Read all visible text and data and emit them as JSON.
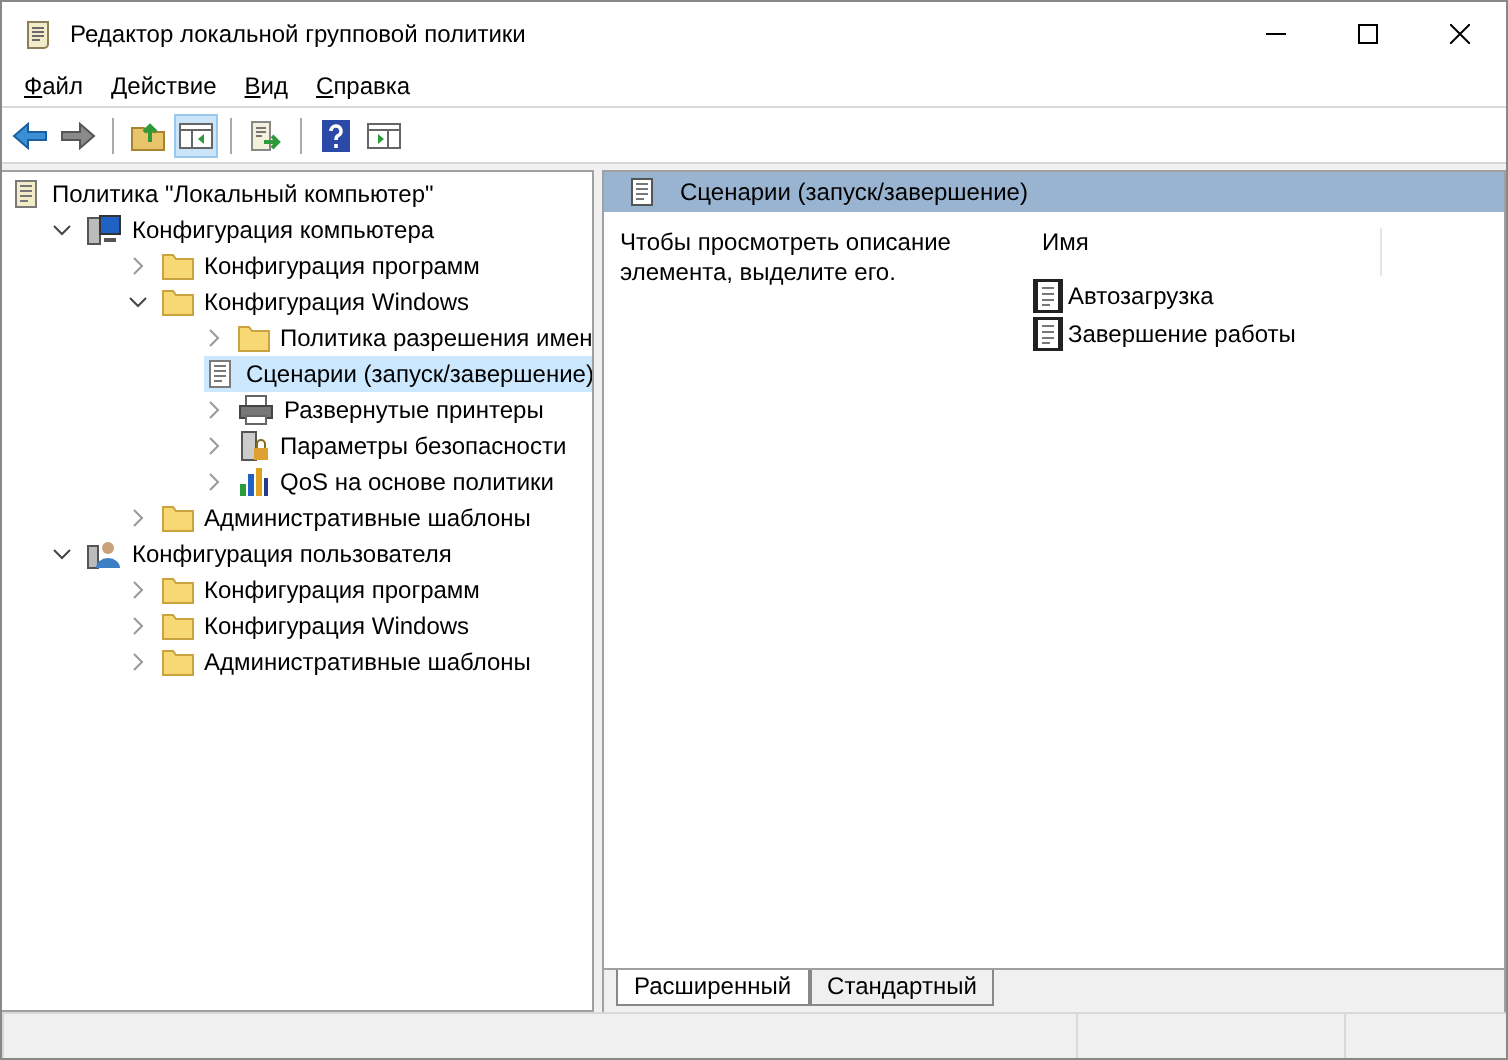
{
  "window": {
    "title": "Редактор локальной групповой политики"
  },
  "menu": [
    {
      "label": "Файл"
    },
    {
      "label": "Действие"
    },
    {
      "label": "Вид"
    },
    {
      "label": "Справка"
    }
  ],
  "toolbar": [
    {
      "kind": "back",
      "pressed": false
    },
    {
      "kind": "forward",
      "pressed": false
    },
    {
      "kind": "sep"
    },
    {
      "kind": "up",
      "pressed": false
    },
    {
      "kind": "tree",
      "pressed": true
    },
    {
      "kind": "sep"
    },
    {
      "kind": "export",
      "pressed": false
    },
    {
      "kind": "sep"
    },
    {
      "kind": "help",
      "pressed": false
    },
    {
      "kind": "pane",
      "pressed": false
    }
  ],
  "tree": [
    {
      "label": "Политика \"Локальный компьютер\"",
      "kind": "document",
      "selected": false,
      "children": [
        {
          "label": "Конфигурация компьютера",
          "kind": "computer",
          "expanded": true,
          "selected": false,
          "children": [
            {
              "label": "Конфигурация программ",
              "kind": "folder",
              "expanded": false,
              "selected": false
            },
            {
              "label": "Конфигурация Windows",
              "kind": "folder",
              "expanded": true,
              "selected": false,
              "children": [
                {
                  "label": "Политика разрешения имен",
                  "kind": "folder",
                  "expanded": false,
                  "selected": false
                },
                {
                  "label": "Сценарии (запуск/завершение)",
                  "kind": "script",
                  "selected": true
                },
                {
                  "label": "Развернутые принтеры",
                  "kind": "printer",
                  "expanded": false,
                  "selected": false
                },
                {
                  "label": "Параметры безопасности",
                  "kind": "security",
                  "expanded": false,
                  "selected": false
                },
                {
                  "label": "QoS на основе политики",
                  "kind": "chart",
                  "expanded": false,
                  "selected": false
                }
              ]
            },
            {
              "label": "Административные шаблоны",
              "kind": "folder",
              "expanded": false,
              "selected": false
            }
          ]
        },
        {
          "label": "Конфигурация пользователя",
          "kind": "user",
          "expanded": true,
          "selected": false,
          "children": [
            {
              "label": "Конфигурация программ",
              "kind": "folder",
              "expanded": false,
              "selected": false
            },
            {
              "label": "Конфигурация Windows",
              "kind": "folder",
              "expanded": false,
              "selected": false
            },
            {
              "label": "Административные шаблоны",
              "kind": "folder",
              "expanded": false,
              "selected": false
            }
          ]
        }
      ]
    }
  ],
  "details": {
    "header": "Сценарии (запуск/завершение)",
    "description": "Чтобы просмотреть описание элемента, выделите его.",
    "column": "Имя",
    "items": [
      {
        "label": "Автозагрузка"
      },
      {
        "label": "Завершение работы"
      }
    ]
  },
  "view_tabs": [
    {
      "label": "Расширенный",
      "selected": true
    },
    {
      "label": "Стандартный",
      "selected": false
    }
  ]
}
